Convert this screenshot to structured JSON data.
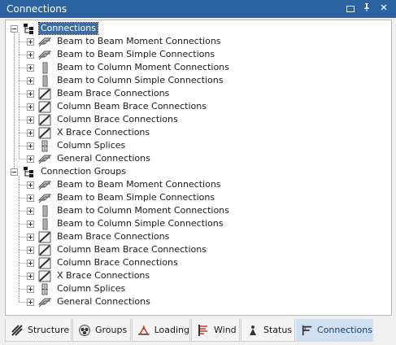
{
  "window": {
    "title": "Connections"
  },
  "tree": {
    "roots": [
      {
        "label": "Connections",
        "selected": true,
        "items": [
          {
            "label": "Beam to Beam Moment Connections",
            "icon": "beam-beam-icon"
          },
          {
            "label": "Beam to Beam Simple Connections",
            "icon": "beam-beam-icon"
          },
          {
            "label": "Beam to Column Moment Connections",
            "icon": "beam-column-icon"
          },
          {
            "label": "Beam to Column Simple Connections",
            "icon": "beam-column-icon"
          },
          {
            "label": "Beam Brace Connections",
            "icon": "brace-icon"
          },
          {
            "label": "Column Beam Brace Connections",
            "icon": "brace-icon"
          },
          {
            "label": "Column Brace Connections",
            "icon": "brace-icon"
          },
          {
            "label": "X Brace Connections",
            "icon": "brace-icon"
          },
          {
            "label": "Column Splices",
            "icon": "column-splice-icon"
          },
          {
            "label": "General Connections",
            "icon": "beam-beam-icon"
          }
        ]
      },
      {
        "label": "Connection Groups",
        "selected": false,
        "items": [
          {
            "label": "Beam to Beam Moment Connections",
            "icon": "beam-beam-icon"
          },
          {
            "label": "Beam to Beam Simple Connections",
            "icon": "beam-beam-icon"
          },
          {
            "label": "Beam to Column Moment Connections",
            "icon": "beam-column-icon"
          },
          {
            "label": "Beam to Column Simple Connections",
            "icon": "beam-column-icon"
          },
          {
            "label": "Beam Brace Connections",
            "icon": "brace-icon"
          },
          {
            "label": "Column Beam Brace Connections",
            "icon": "brace-icon"
          },
          {
            "label": "Column Brace Connections",
            "icon": "brace-icon"
          },
          {
            "label": "X Brace Connections",
            "icon": "brace-icon"
          },
          {
            "label": "Column Splices",
            "icon": "column-splice-icon"
          },
          {
            "label": "General Connections",
            "icon": "beam-beam-icon"
          }
        ]
      }
    ]
  },
  "tabs": [
    {
      "label": "Structure",
      "icon": "structure-icon",
      "active": false
    },
    {
      "label": "Groups",
      "icon": "groups-icon",
      "active": false
    },
    {
      "label": "Loading",
      "icon": "loading-icon",
      "active": false
    },
    {
      "label": "Wind",
      "icon": "wind-icon",
      "active": false
    },
    {
      "label": "Status",
      "icon": "status-icon",
      "active": false
    },
    {
      "label": "Connections",
      "icon": "connections-icon",
      "active": true
    }
  ],
  "colors": {
    "titlebar": "#2b63a0",
    "selection": "#3a6ea5",
    "active_tab": "#cfe0f1"
  }
}
